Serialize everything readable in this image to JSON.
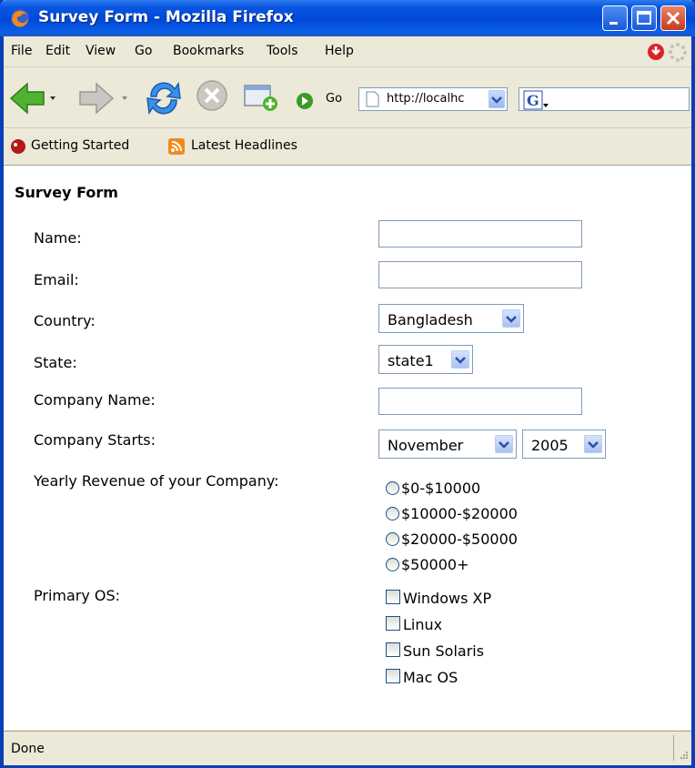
{
  "window": {
    "title": "Survey Form - Mozilla Firefox"
  },
  "menu": [
    "File",
    "Edit",
    "View",
    "Go",
    "Bookmarks",
    "Tools",
    "Help"
  ],
  "navbar": {
    "go_label": "Go",
    "url": "http://localhc"
  },
  "bookmarks": [
    "Getting Started",
    "Latest Headlines"
  ],
  "form": {
    "title": "Survey Form",
    "name_label": "Name:",
    "email_label": "Email:",
    "country_label": "Country:",
    "country_value": "Bangladesh",
    "state_label": "State:",
    "state_value": "state1",
    "company_label": "Company Name:",
    "starts_label": "Company Starts:",
    "month_value": "November",
    "year_value": "2005",
    "revenue_label": "Yearly Revenue of your Company:",
    "revenue_options": [
      "$0-$10000",
      "$10000-$20000",
      "$20000-$50000",
      "$50000+"
    ],
    "os_label": "Primary OS:",
    "os_options": [
      "Windows XP",
      "Linux",
      "Sun Solaris",
      "Mac OS"
    ]
  },
  "status": {
    "text": "Done"
  }
}
